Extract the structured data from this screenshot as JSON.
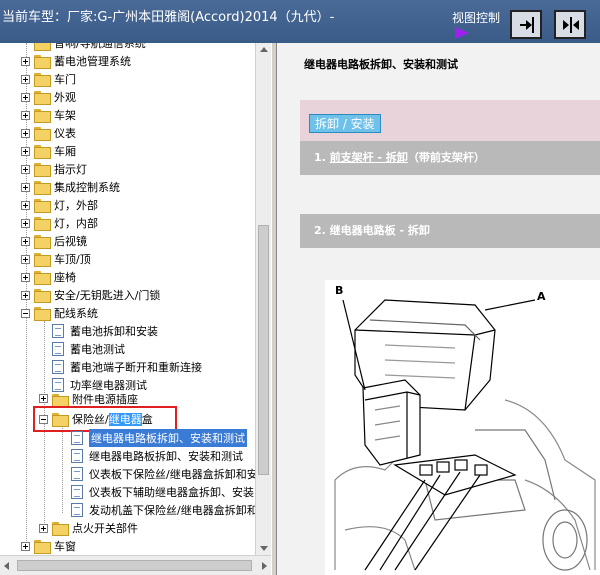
{
  "header": {
    "title": "当前车型：厂家:G-广州本田雅阁(Accord)2014（九代）-",
    "view_label": "视图控制"
  },
  "tree": {
    "top_partial": "音响/导航通信系统",
    "items": [
      {
        "label": "蓄电池管理系统"
      },
      {
        "label": "车门"
      },
      {
        "label": "外观"
      },
      {
        "label": "车架"
      },
      {
        "label": "仪表"
      },
      {
        "label": "车厢"
      },
      {
        "label": "指示灯"
      },
      {
        "label": "集成控制系统"
      },
      {
        "label": "灯，外部"
      },
      {
        "label": "灯，内部"
      },
      {
        "label": "后视镜"
      },
      {
        "label": "车顶/顶"
      },
      {
        "label": "座椅"
      },
      {
        "label": "安全/无钥匙进入/门锁"
      },
      {
        "label": "配线系统"
      }
    ],
    "wiring_children": [
      {
        "label": "蓄电池拆卸和安装"
      },
      {
        "label": "蓄电池测试"
      },
      {
        "label": "蓄电池端子断开和重新连接"
      },
      {
        "label": "功率继电器测试"
      },
      {
        "label": "附件电源插座"
      }
    ],
    "fuse_box": {
      "prefix": "保险丝/",
      "highlight": "继电器",
      "suffix": "盒"
    },
    "fuse_children": [
      {
        "label": "继电器电路板拆卸、安装和测试"
      },
      {
        "label": "继电器电路板拆卸、安装和测试"
      },
      {
        "label": "仪表板下保险丝/继电器盒拆卸和安装"
      },
      {
        "label": "仪表板下辅助继电器盒拆卸、安装"
      },
      {
        "label": "发动机盖下保险丝/继电器盒拆卸和"
      }
    ],
    "ignition": {
      "label": "点火开关部件"
    },
    "window": {
      "label": "车窗"
    }
  },
  "content": {
    "page_title": "继电器电路板拆卸、安装和测试",
    "tab_label": "拆卸 / 安装",
    "step1_num": "1.",
    "step1_link": "前支架杆 - 拆卸",
    "step1_rest": "（带前支架杆）",
    "step2": "2. 继电器电路板 - 拆卸",
    "callout_a": "A",
    "callout_b": "B"
  },
  "colors": {
    "header_bg": "#3a5a88",
    "tab_bg": "#6fc1ea",
    "step_bg": "#b9b9b9",
    "selection": "#3a7bd5",
    "red_box": "#e02020"
  }
}
